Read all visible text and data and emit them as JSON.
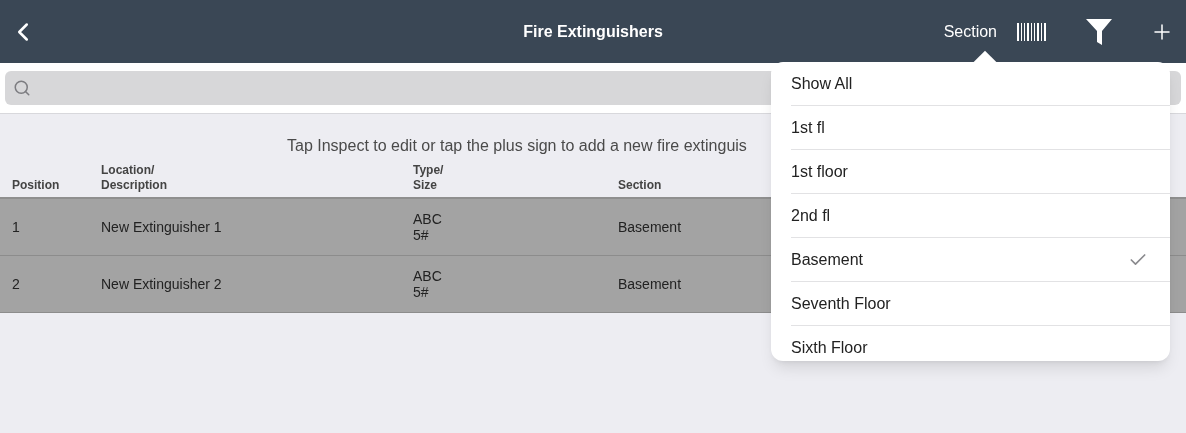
{
  "header": {
    "title": "Fire Extinguishers",
    "section_button": "Section"
  },
  "instruction": "Tap Inspect to edit or tap the plus sign to add a new fire extinguis",
  "table": {
    "columns": [
      "Position",
      "Location/\nDescription",
      "Type/\nSize",
      "Section"
    ],
    "rows": [
      {
        "cells": [
          "1",
          "New Extinguisher 1",
          "ABC\n5#",
          "Basement"
        ]
      },
      {
        "cells": [
          "2",
          "New Extinguisher 2",
          "ABC\n5#",
          "Basement"
        ]
      }
    ]
  },
  "section_menu": {
    "items": [
      {
        "label": "Show All",
        "selected": false
      },
      {
        "label": "1st fl",
        "selected": false
      },
      {
        "label": "1st floor",
        "selected": false
      },
      {
        "label": "2nd fl",
        "selected": false
      },
      {
        "label": "Basement",
        "selected": true
      },
      {
        "label": "Seventh Floor",
        "selected": false
      },
      {
        "label": "Sixth Floor",
        "selected": false
      }
    ]
  }
}
